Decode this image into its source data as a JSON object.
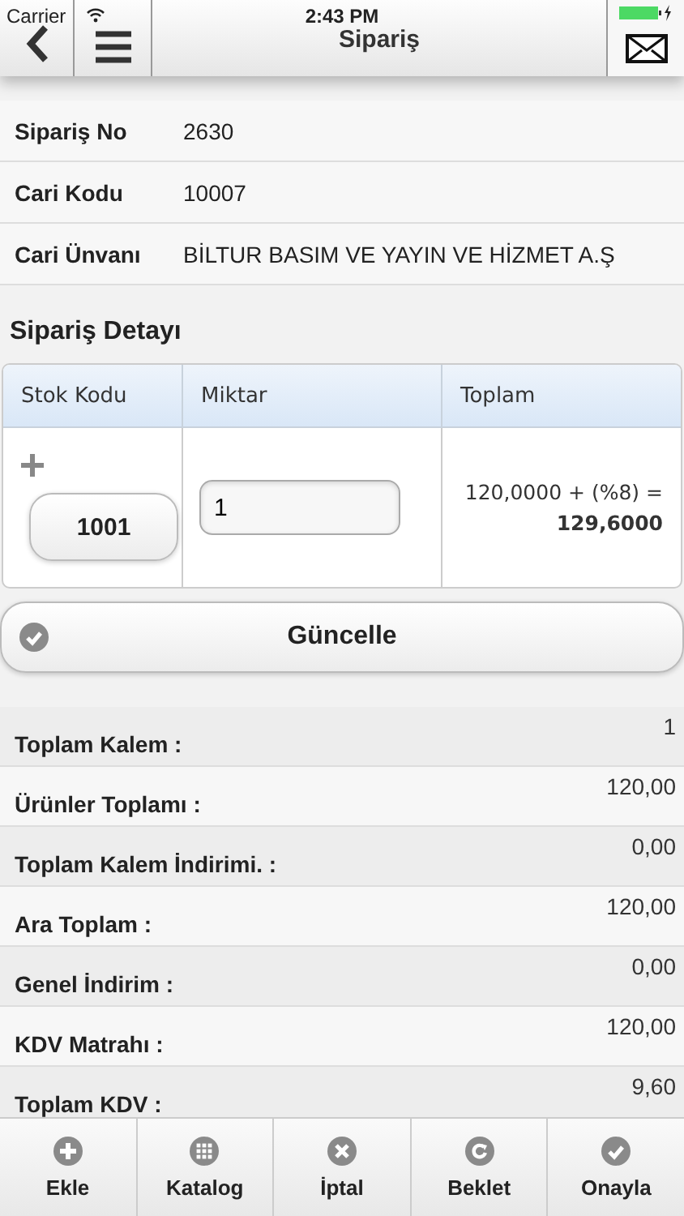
{
  "status_bar": {
    "carrier": "Carrier",
    "time": "2:43 PM"
  },
  "header": {
    "title": "Sipariş"
  },
  "info": [
    {
      "label": "Sipariş No",
      "value": "2630"
    },
    {
      "label": "Cari Kodu",
      "value": "10007"
    },
    {
      "label": "Cari Ünvanı",
      "value": "BİLTUR BASIM VE YAYIN VE HİZMET A.Ş"
    }
  ],
  "detail": {
    "title": "Sipariş Detayı",
    "columns": [
      "Stok Kodu",
      "Miktar",
      "Toplam"
    ],
    "rows": [
      {
        "stock_code": "1001",
        "quantity": "1",
        "total_formula": "120,0000 + (%8) =",
        "total": "129,6000"
      }
    ]
  },
  "update_button": "Güncelle",
  "summary": [
    {
      "label": "Toplam Kalem :",
      "value": "1"
    },
    {
      "label": "Ürünler Toplamı :",
      "value": "120,00"
    },
    {
      "label": "Toplam Kalem İndirimi. :",
      "value": "0,00"
    },
    {
      "label": "Ara Toplam :",
      "value": "120,00"
    },
    {
      "label": "Genel İndirim :",
      "value": "0,00"
    },
    {
      "label": "KDV Matrahı :",
      "value": "120,00"
    },
    {
      "label": "Toplam KDV :",
      "value": "9,60"
    }
  ],
  "tab_bar": [
    {
      "kind": "add",
      "label": "Ekle"
    },
    {
      "kind": "catalog",
      "label": "Katalog"
    },
    {
      "kind": "cancel",
      "label": "İptal"
    },
    {
      "kind": "hold",
      "label": "Beklet"
    },
    {
      "kind": "confirm",
      "label": "Onayla"
    }
  ]
}
